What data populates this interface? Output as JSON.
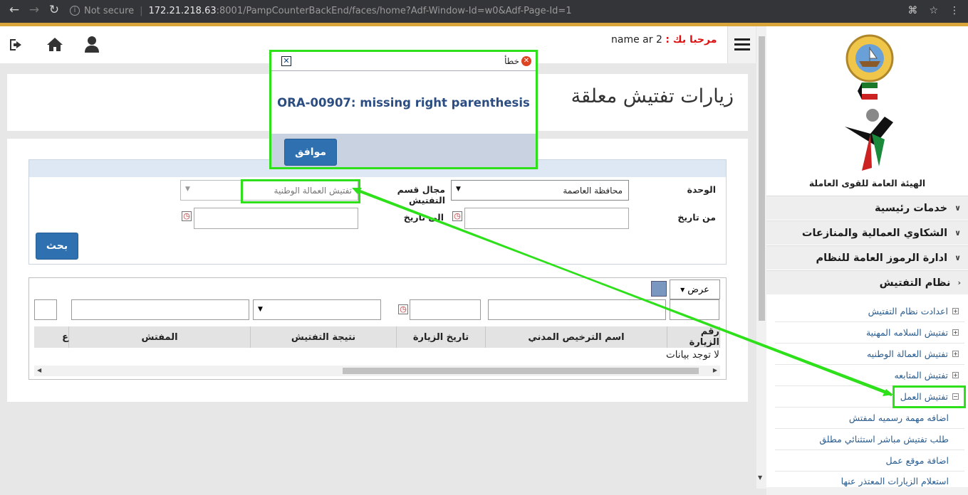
{
  "browser": {
    "security": "Not secure",
    "host": "172.21.218.63",
    "path": ":8001/PampCounterBackEnd/faces/home?Adf-Window-Id=w0&Adf-Page-Id=1"
  },
  "header": {
    "welcome_label": "مرحبا بك :",
    "user_name": "name ar 2"
  },
  "org_name": "الهيئة العامة للقوى العاملة",
  "page_title": "زيارات تفتيش معلقة",
  "search": {
    "unit_label": "الوحدة",
    "unit_value": "محافظة العاصمة",
    "field_label": "مجال قسم التفتيش",
    "field_value": "تفتيش العمالة الوطنية",
    "from_label": "من تاريخ",
    "to_label": "الى تاريخ",
    "search_button": "بحث"
  },
  "table": {
    "view_menu": "عرض",
    "columns": [
      "رقم الزيارة",
      "اسم الترخيص المدني",
      "تاريخ الزيارة",
      "نتيجة التفتيش",
      "المفتش",
      "ع"
    ],
    "empty_text": "لا توجد بيانات"
  },
  "sidebar": {
    "sections": [
      {
        "label": "خدمات رئيسية",
        "chevron": "∨"
      },
      {
        "label": "الشكاوي العمالية والمنازعات",
        "chevron": "∨"
      },
      {
        "label": "ادارة الرموز العامة للنظام",
        "chevron": "∨"
      },
      {
        "label": "نظام التفتيش",
        "chevron": "›"
      }
    ],
    "subitems": [
      "اعدادت نظام التفتيش",
      "تفتيش السلامه المهنية",
      "تفتيش العمالة الوطنيه",
      "تفتيش المتابعه",
      "تفتيش العمل"
    ],
    "leaves": [
      "اضافه مهمة رسميه لمفتش",
      "طلب تفتيش مباشر استثنائي مطلق",
      "اضافة موقع عمل",
      "استعلام الزيارات المعتذر عنها"
    ]
  },
  "dialog": {
    "title": "خطأ",
    "message": "ORA-00907: missing right parenthesis",
    "ok_button": "موافق"
  },
  "colors": {
    "highlight": "#2de01a",
    "primary_button": "#2f71b0",
    "gold_bar": "#d9a53b"
  }
}
